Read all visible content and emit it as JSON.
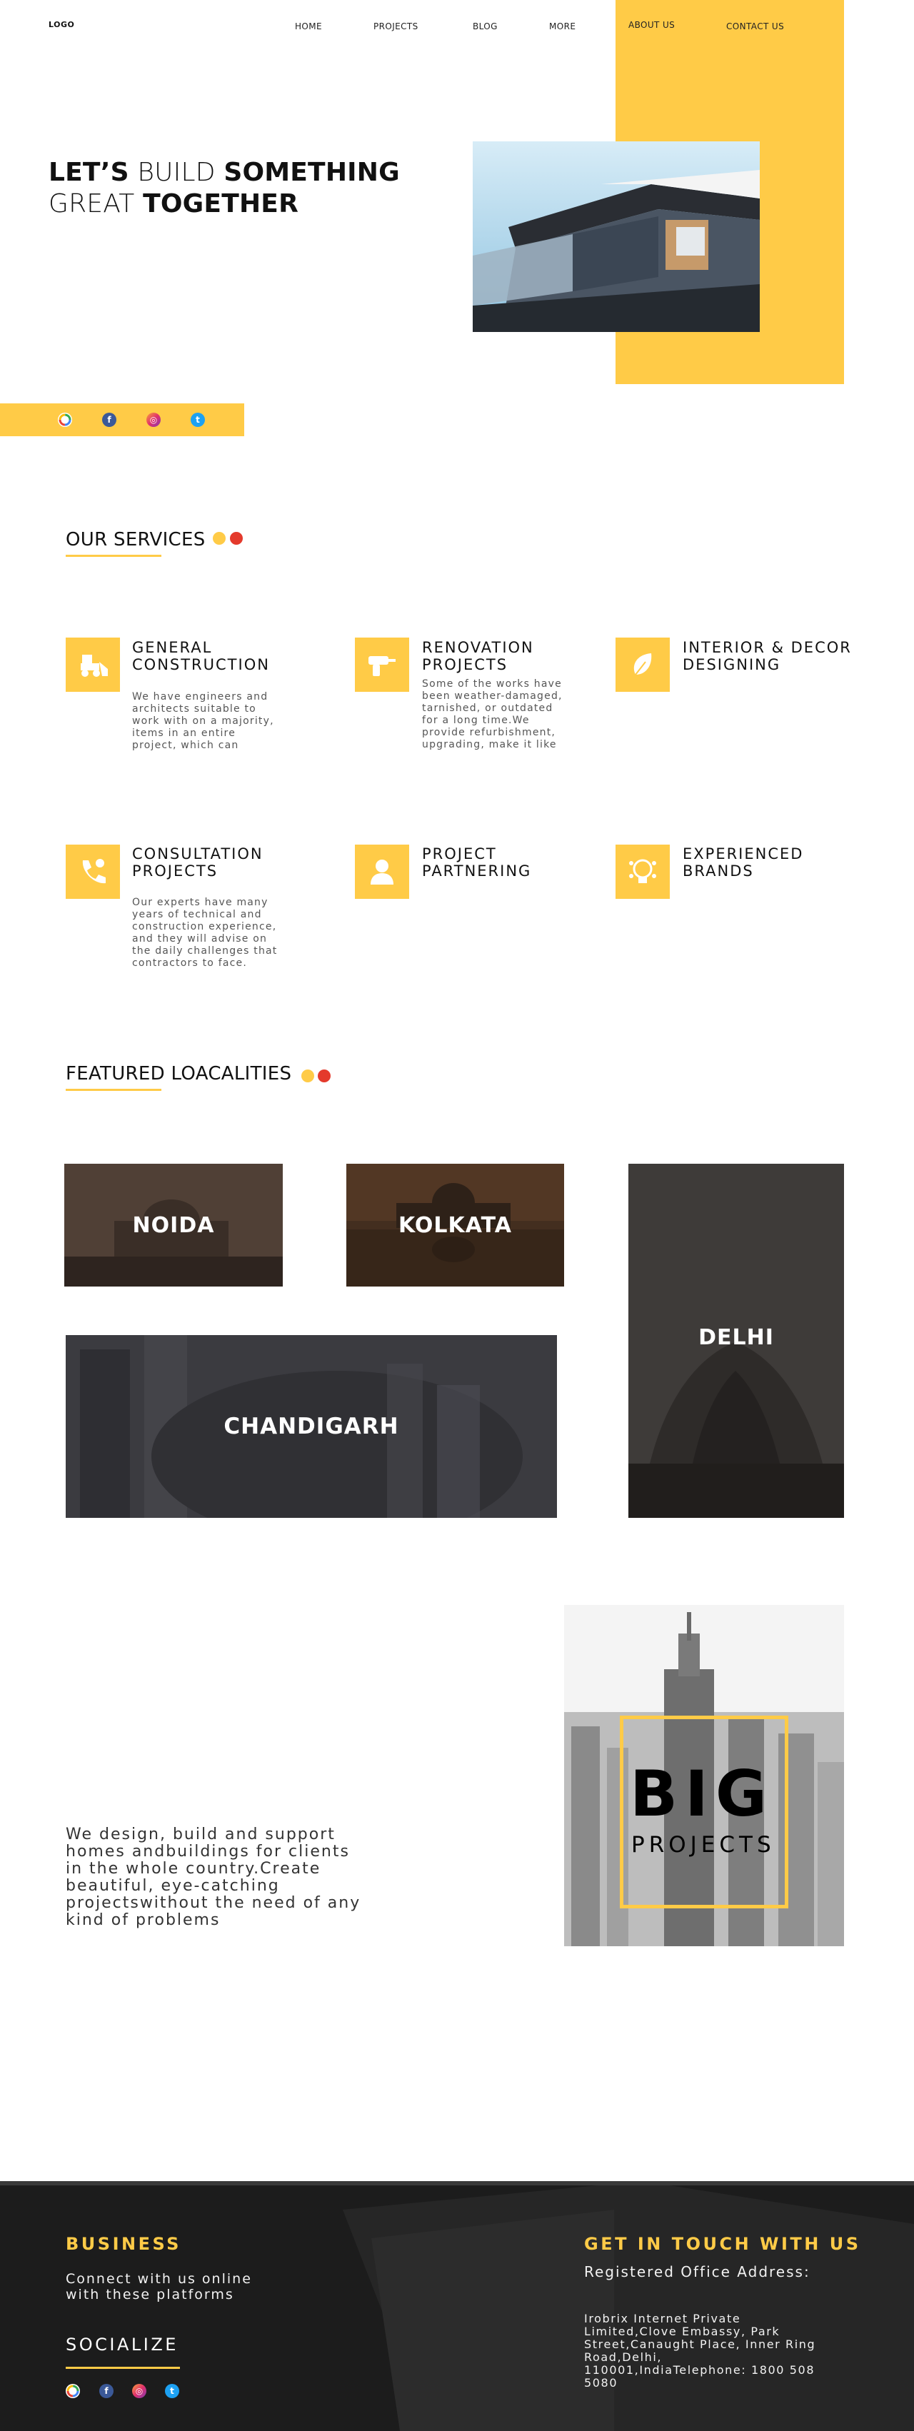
{
  "nav": {
    "logo": "LOGO",
    "items": [
      "HOME",
      "PROJECTS",
      "BLOG",
      "MORE",
      "ABOUT US",
      "CONTACT US"
    ]
  },
  "hero": {
    "line1_bold": "LET’S",
    "line1_light": " BUILD ",
    "line1_bold2": "SOMETHING",
    "line2_light": "GREAT ",
    "line2_bold": "TOGETHER"
  },
  "social_icons": [
    "google-icon",
    "facebook-icon",
    "instagram-icon",
    "twitter-icon"
  ],
  "services": {
    "title": "OUR SERVICES",
    "items": [
      {
        "icon": "bulldozer-icon",
        "title": "GENERAL CONSTRUCTION",
        "text": "We have engineers and architects suitable to work with on a majority, items in an entire project, which can"
      },
      {
        "icon": "drill-icon",
        "title": "RENOVATION PROJECTS",
        "text": "Some of the works have been weather-damaged, tarnished, or outdated for a long time.We provide refurbishment, upgrading, make it like"
      },
      {
        "icon": "leaf-icon",
        "title": "INTERIOR & DECOR DESIGNING",
        "text": ""
      },
      {
        "icon": "phone-icon",
        "title": "CONSULTATION PROJECTS",
        "text": "Our experts have many years of technical and construction experience, and they will advise on the daily challenges that contractors to face."
      },
      {
        "icon": "person-icon",
        "title": "PROJECT PARTNERING",
        "text": ""
      },
      {
        "icon": "brain-icon",
        "title": "EXPERIENCED BRANDS",
        "text": ""
      }
    ]
  },
  "localities": {
    "title": "FEATURED LOACALITIES",
    "items": [
      "NOIDA",
      "KOLKATA",
      "DELHI",
      "CHANDIGARH"
    ]
  },
  "about": {
    "text": "We design, build and support homes andbuildings for clients in the whole country.Create beautiful, eye-catching projectswithout the need of any kind of problems",
    "big_title": "BIG",
    "big_subtitle": "PROJECTS"
  },
  "footer": {
    "business_title": "BUSINESS",
    "business_text": "Connect with us online with these platforms",
    "socialize_title": "SOCIALIZE",
    "contact_title": "GET IN TOUCH WITH US",
    "office_label": "Registered Office Address:",
    "address": "Irobrix Internet Private Limited,Clove Embassy, Park Street,Canaught Place, Inner Ring Road,Delhi, 110001,IndiaTelephone: 1800 508 5080"
  },
  "colors": {
    "accent": "#ffcb47",
    "red_dot": "#e43a2c",
    "footer_bg": "#1c1c1c"
  }
}
